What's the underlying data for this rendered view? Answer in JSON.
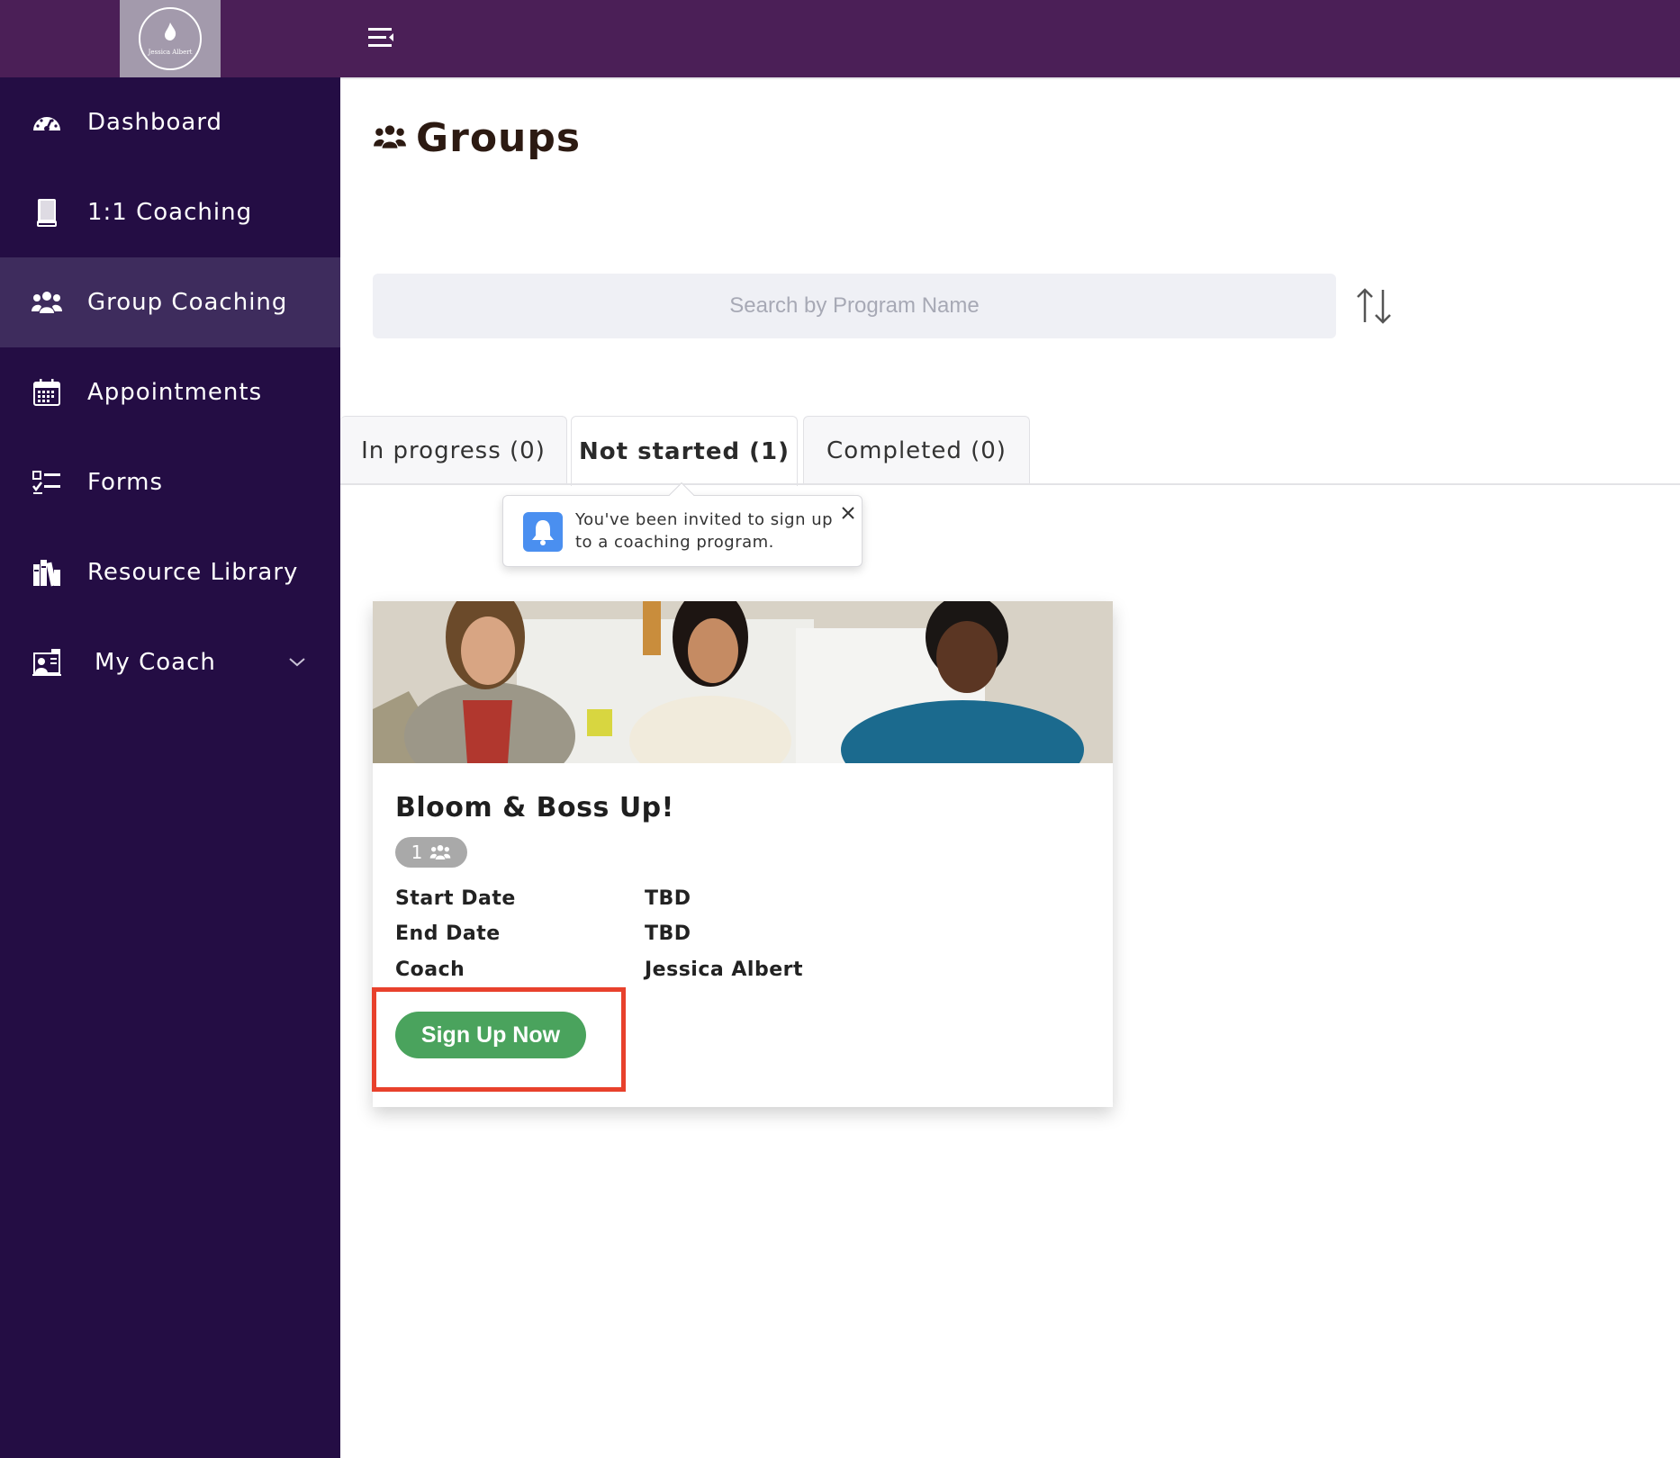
{
  "header": {
    "logo_signature": "Jessica Albert",
    "menu_toggle_icon": "menu-collapse-icon"
  },
  "sidebar": {
    "items": [
      {
        "label": "Dashboard",
        "icon": "dashboard-gauge-icon",
        "active": false
      },
      {
        "label": "1:1 Coaching",
        "icon": "book-icon",
        "active": false
      },
      {
        "label": "Group Coaching",
        "icon": "users-icon",
        "active": true
      },
      {
        "label": "Appointments",
        "icon": "calendar-icon",
        "active": false
      },
      {
        "label": "Forms",
        "icon": "checklist-icon",
        "active": false
      },
      {
        "label": "Resource Library",
        "icon": "library-books-icon",
        "active": false
      },
      {
        "label": "My Coach",
        "icon": "coach-board-icon",
        "active": false,
        "has_dropdown": true
      }
    ]
  },
  "main": {
    "page_title": "Groups",
    "page_title_icon": "users-icon",
    "search": {
      "placeholder": "Search by Program Name",
      "value": ""
    },
    "sort_icon": "sort-up-down-icon",
    "tabs": [
      {
        "label": "In progress (0)",
        "active": false
      },
      {
        "label": "Not started (1)",
        "active": true
      },
      {
        "label": "Completed (0)",
        "active": false
      }
    ],
    "tooltip": {
      "text": "You've been invited to sign up to a coaching program.",
      "icon": "bell-icon",
      "close_icon": "close-icon"
    },
    "card": {
      "image_alt": "three-women-photo",
      "title": "Bloom & Boss Up!",
      "members_count": "1",
      "details": [
        {
          "label": "Start Date",
          "value": "TBD"
        },
        {
          "label": "End Date",
          "value": "TBD"
        },
        {
          "label": "Coach",
          "value": "Jessica Albert"
        }
      ],
      "signup_label": "Sign Up Now"
    }
  },
  "colors": {
    "topbar": "#4b1f57",
    "sidebar": "#240d44",
    "sidebar_active": "#3e2c5d",
    "signup_green": "#4aa35d",
    "highlight_red": "#e8412c",
    "bell_blue": "#4a8ff0"
  }
}
